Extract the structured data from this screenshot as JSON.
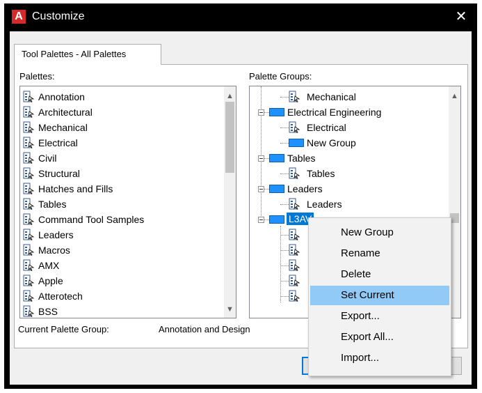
{
  "window": {
    "title": "Customize",
    "app_icon_letter": "A",
    "close_glyph": "✕"
  },
  "tab": {
    "label": "Tool Palettes - All Palettes"
  },
  "palettes": {
    "label": "Palettes:",
    "items": [
      "Annotation",
      "Architectural",
      "Mechanical",
      "Electrical",
      "Civil",
      "Structural",
      "Hatches and Fills",
      "Tables",
      "Command Tool Samples",
      "Leaders",
      "Macros",
      "AMX",
      "Apple",
      "Atterotech",
      "BSS"
    ]
  },
  "palette_groups": {
    "label": "Palette Groups:",
    "nodes": [
      {
        "text": "Mechanical",
        "level": 1,
        "icon": "palette-icon"
      },
      {
        "text": "Electrical Engineering",
        "level": 0,
        "icon": "group-icon"
      },
      {
        "text": "Electrical",
        "level": 1,
        "icon": "palette-icon"
      },
      {
        "text": "New Group",
        "level": 1,
        "icon": "group-icon"
      },
      {
        "text": "Tables",
        "level": 0,
        "icon": "group-icon"
      },
      {
        "text": "Tables",
        "level": 1,
        "icon": "palette-icon"
      },
      {
        "text": "Leaders",
        "level": 0,
        "icon": "group-icon"
      },
      {
        "text": "Leaders",
        "level": 1,
        "icon": "palette-icon"
      },
      {
        "text": "L3AV",
        "level": 0,
        "icon": "group-icon",
        "selected": true
      }
    ]
  },
  "current_group": {
    "label": "Current Palette Group:",
    "value": "Annotation and Design"
  },
  "context_menu": {
    "items": [
      {
        "label": "New Group"
      },
      {
        "label": "Rename"
      },
      {
        "label": "Delete"
      },
      {
        "label": "Set Current",
        "hovered": true
      },
      {
        "label": "Export..."
      },
      {
        "label": "Export All..."
      },
      {
        "label": "Import..."
      }
    ]
  },
  "colors": {
    "accent": "#0078d7",
    "menu_hover": "#91c9f7",
    "title_bg": "#000000",
    "app_icon": "#d42a2a"
  }
}
